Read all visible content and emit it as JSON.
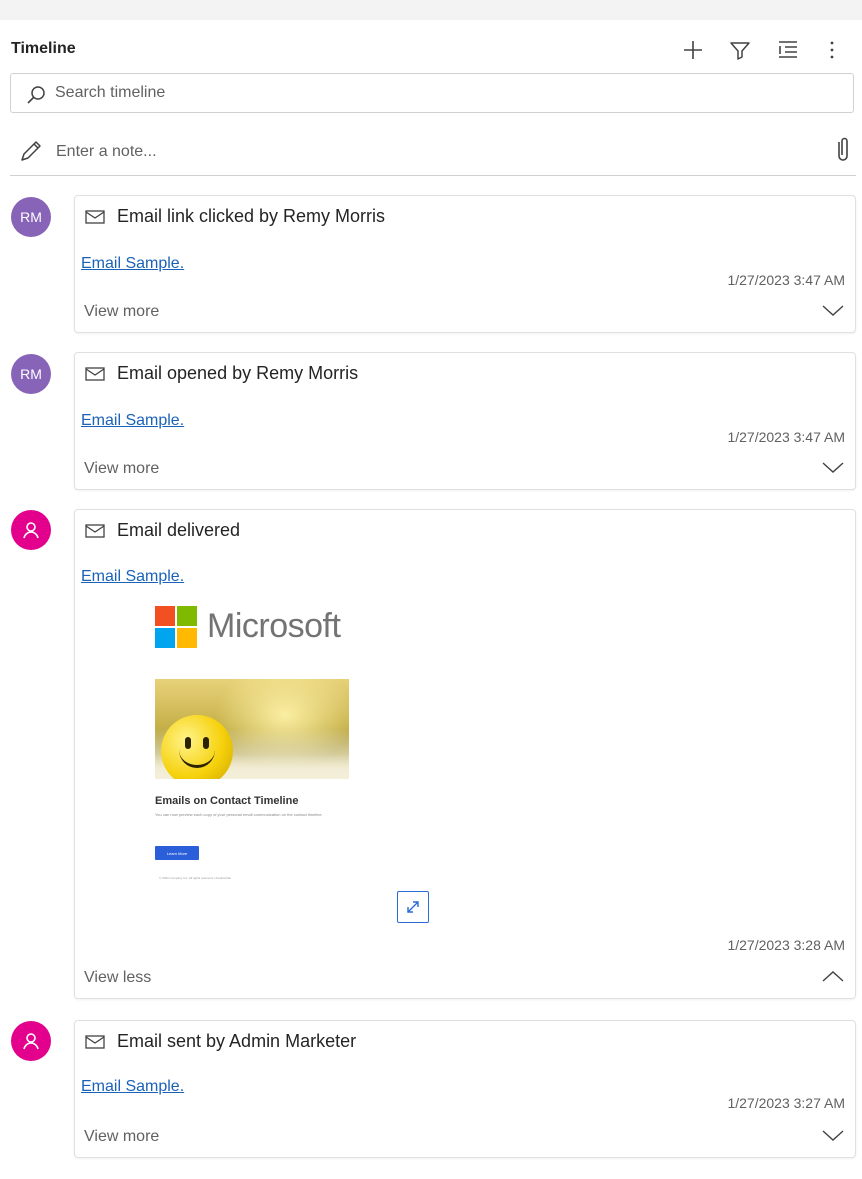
{
  "header": {
    "title": "Timeline",
    "tools": [
      {
        "name": "add-icon"
      },
      {
        "name": "filter-icon"
      },
      {
        "name": "list-view-icon"
      },
      {
        "name": "more-options-icon"
      }
    ]
  },
  "search": {
    "placeholder": "Search timeline",
    "value": "",
    "icon": "search-icon"
  },
  "note": {
    "placeholder": "Enter a note...",
    "value": "",
    "icon": "pencil-icon",
    "attach_icon": "paperclip-icon"
  },
  "entries": [
    {
      "avatar_initials": "RM",
      "title": "Email link clicked by Remy Morris",
      "link": "Email Sample.",
      "time": "1/27/2023 3:47 AM",
      "toggle": "View more"
    },
    {
      "avatar_initials": "RM",
      "title": "Email opened by Remy Morris",
      "link": "Email Sample.",
      "time": "1/27/2023 3:47 AM",
      "toggle": "View more"
    },
    {
      "avatar_initials": "",
      "avatar_icon": "person-icon",
      "title": "Email delivered",
      "link": "Email Sample.",
      "time": "1/27/2023 3:28 AM",
      "toggle": "View less",
      "preview": {
        "brand": "Microsoft",
        "heading": "Emails on Contact Timeline",
        "body": "You can now preview each copy of your personal email communication on the contact timeline.",
        "button": "Learn More",
        "footer": "© 2023 Company Inc. All rights reserved. Unsubscribe"
      }
    },
    {
      "avatar_initials": "",
      "avatar_icon": "person-icon",
      "title": "Email sent by Admin Marketer",
      "link": "Email Sample.",
      "time": "1/27/2023 3:27 AM",
      "toggle": "View more"
    }
  ],
  "colors": {
    "link": "#1a62b8",
    "avatar_contact": "#8764b8",
    "avatar_system": "#e3008c",
    "preview_button": "#2b5fd9"
  }
}
